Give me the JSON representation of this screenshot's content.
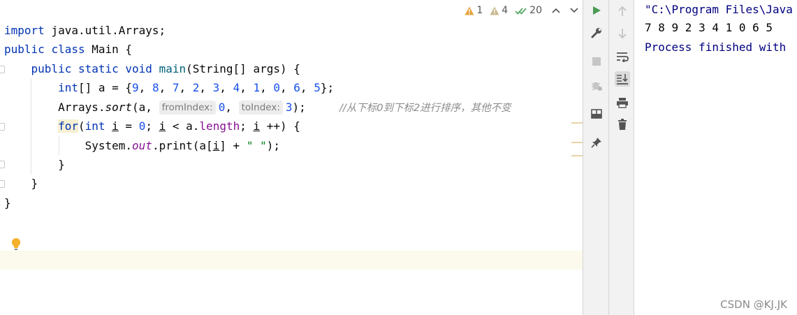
{
  "inspections": {
    "warnings": "1",
    "weak_warnings": "4",
    "typos": "20"
  },
  "colors": {
    "warning": "#e8a33d",
    "typo_check": "#59a869",
    "run_green": "#499c54",
    "bulb": "#f2b02b",
    "keyword": "#0033b3",
    "number": "#1750eb",
    "string": "#067d17",
    "field": "#871094",
    "comment": "#8c8c8c",
    "console_text": "#000080"
  },
  "code": {
    "l1_kw": "import",
    "l1_rest": " java.util.Arrays;",
    "l2_kw1": "public",
    "l2_kw2": "class",
    "l2_rest": " Main {",
    "l3_kw1": "public",
    "l3_kw2": "static",
    "l3_kw3": "void",
    "l3_method": "main",
    "l3_rest": "(String[] args) {",
    "l4_kw": "int",
    "l4_mid": "[] a = {",
    "l4_nums": [
      "9",
      "8",
      "7",
      "2",
      "3",
      "4",
      "1",
      "0",
      "6",
      "5"
    ],
    "l4_end": "};",
    "l5_class": "Arrays.",
    "l5_method": "sort",
    "l5_open": "(a, ",
    "l5_hint1": "fromIndex:",
    "l5_arg1": "0",
    "l5_comma": ", ",
    "l5_hint2": "toIndex:",
    "l5_arg2": "3",
    "l5_end": ");",
    "l5_comment": "//从下标0到下标2进行排序，其他不变",
    "l6_for": "for",
    "l6_open": "(",
    "l6_int": "int",
    "l6_sp": " ",
    "l6_i1": "i",
    "l6_eq": " = ",
    "l6_zero": "0",
    "l6_semi": "; ",
    "l6_i2": "i",
    "l6_lt": " < a.",
    "l6_len": "length",
    "l6_semi2": "; ",
    "l6_i3": "i",
    "l6_end": " ++) {",
    "l7_a": "System.",
    "l7_out": "out",
    "l7_b": ".print(a[",
    "l7_i": "i",
    "l7_c": "] + ",
    "l7_str": "\" \"",
    "l7_d": ");",
    "l8": "}",
    "l9": "}",
    "l10": "}"
  },
  "console": {
    "command": "\"C:\\Program Files\\Java",
    "output": "7 8 9 2 3 4 1 0 6 5",
    "finished": "Process finished with"
  },
  "icons": {
    "run": "run-icon",
    "wrench": "wrench-icon",
    "stop": "stop-icon",
    "debug": "debug-icon",
    "layout": "layout-icon",
    "pin": "pin-icon",
    "up": "up-arrow-icon",
    "down": "down-arrow-icon",
    "wrap": "soft-wrap-icon",
    "scroll": "scroll-to-end-icon",
    "print": "print-icon",
    "trash": "trash-icon"
  },
  "watermark": "CSDN @KJ.JK"
}
